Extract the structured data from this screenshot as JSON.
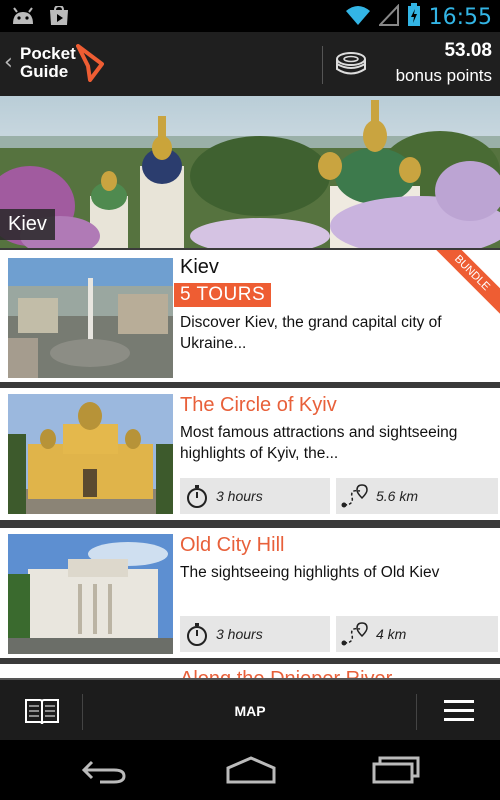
{
  "status_bar": {
    "time": "16:55"
  },
  "header": {
    "logo_line1": "Pocket",
    "logo_line2": "Guide",
    "bonus_value": "53.08",
    "bonus_label": "bonus points"
  },
  "hero": {
    "city": "Kiev"
  },
  "cards": [
    {
      "title": "Kiev",
      "badge": "5 TOURS",
      "ribbon": "BUNDLE",
      "description": "Discover Kiev, the grand capital city of Ukraine..."
    },
    {
      "title": "The Circle of Kyiv",
      "description": "Most famous attractions and sightseeing highlights of Kyiv, the...",
      "duration": "3 hours",
      "distance": "5.6 km"
    },
    {
      "title": "Old City Hill",
      "description": "The sightseeing highlights of Old Kiev",
      "duration": "3 hours",
      "distance": "4 km"
    },
    {
      "title": "Along the Dnieper River"
    }
  ],
  "bottom_bar": {
    "map_label": "MAP"
  },
  "colors": {
    "accent": "#ee5d33",
    "title_orange": "#e8603a",
    "status_blue": "#33b5e5"
  }
}
